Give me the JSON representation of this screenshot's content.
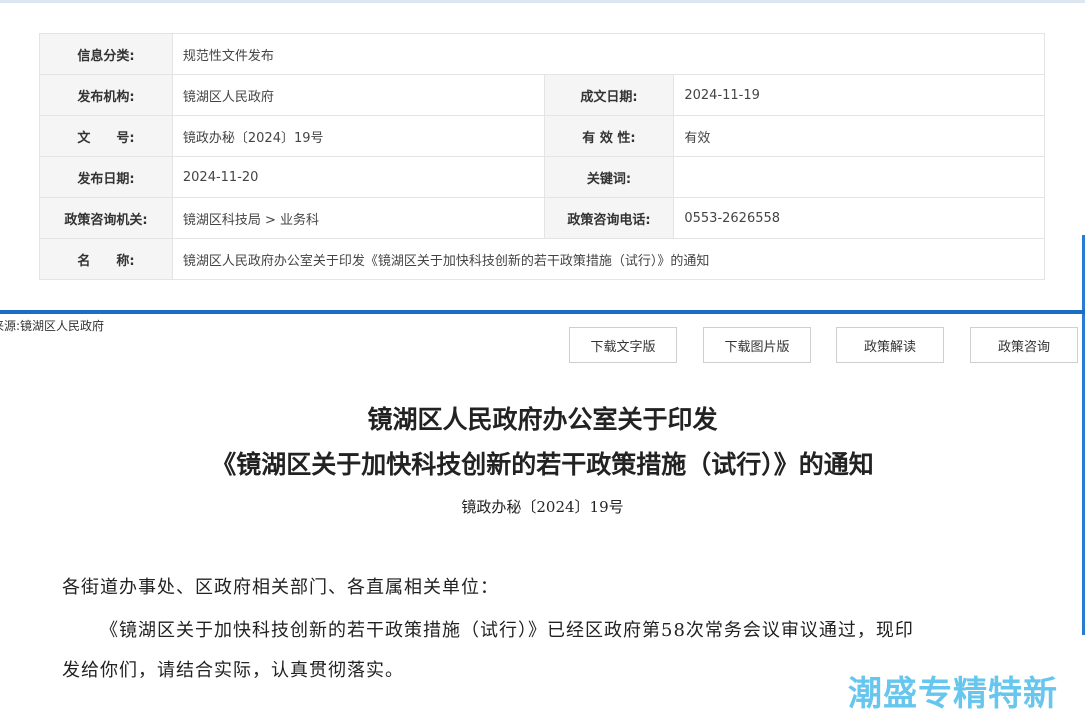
{
  "info": {
    "category_label": "信息分类:",
    "category_value": "规范性文件发布",
    "publisher_label": "发布机构:",
    "publisher_value": "镜湖区人民政府",
    "created_label": "成文日期:",
    "created_value": "2024-11-19",
    "docno_label": "文　　号:",
    "docno_value": "镜政办秘〔2024〕19号",
    "validity_label": "有 效 性:",
    "validity_value": "有效",
    "pubdate_label": "发布日期:",
    "pubdate_value": "2024-11-20",
    "keywords_label": "关键词:",
    "keywords_value": "",
    "consult_org_label": "政策咨询机关:",
    "consult_org_value": "镜湖区科技局 > 业务科",
    "consult_phone_label": "政策咨询电话:",
    "consult_phone_value": "0553-2626558",
    "name_label": "名　　称:",
    "name_value": "镜湖区人民政府办公室关于印发《镜湖区关于加快科技创新的若干政策措施（试行）》的通知"
  },
  "source": {
    "label": "来源:",
    "value": "镜湖区人民政府"
  },
  "buttons": {
    "download_text": "下载文字版",
    "download_image": "下载图片版",
    "policy_interpretation": "政策解读",
    "policy_consult": "政策咨询"
  },
  "document": {
    "title_line1": "镜湖区人民政府办公室关于印发",
    "title_line2": "《镜湖区关于加快科技创新的若干政策措施（试行）》的通知",
    "number": "镜政办秘〔2024〕19号",
    "salutation": "各街道办事处、区政府相关部门、各直属相关单位：",
    "body_line1": "《镜湖区关于加快科技创新的若干政策措施（试行）》已经区政府第58次常务会议审议通过，现印",
    "body_line2": "发给你们，请结合实际，认真贯彻落实。"
  },
  "watermark": {
    "text": "潮盛专精特新"
  },
  "colors": {
    "accent_blue": "#1a6fc4",
    "label_bg": "#f5f5f5",
    "watermark": "#66c6ee"
  }
}
